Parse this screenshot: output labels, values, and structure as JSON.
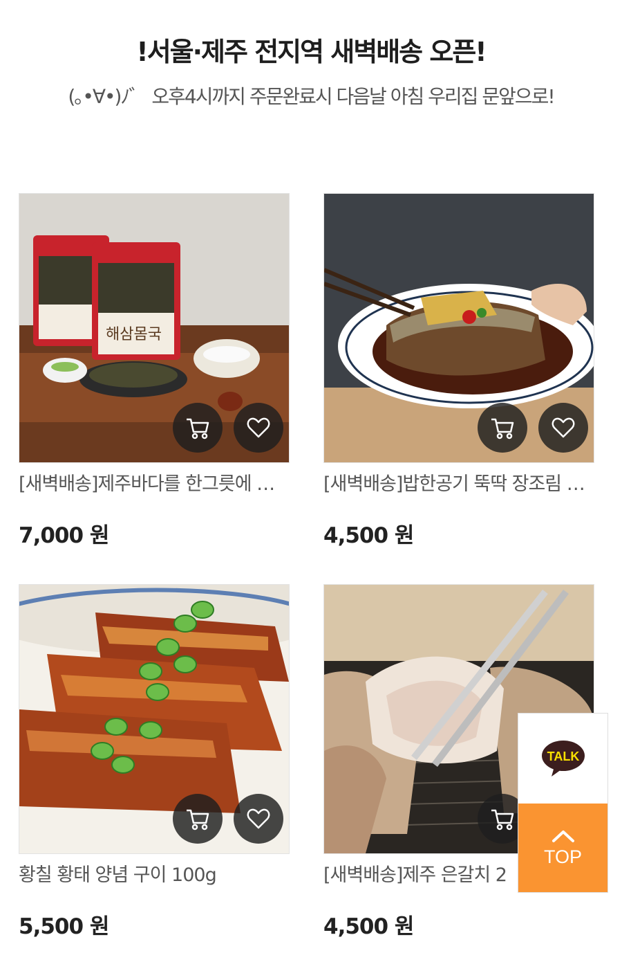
{
  "banner": {
    "title": "!서울·제주 전지역 새벽배송 오픈!",
    "subtitle": "(｡•∀•)ﾉ゛ 오후4시까지 주문완료시 다음날 아침 우리집 문앞으로!"
  },
  "products": [
    {
      "name": "[새벽배송]제주바다를 한그릇에 담은 해삼몸국",
      "price": "7,000 원"
    },
    {
      "name": "[새벽배송]밥한공기 뚝딱 장조림 고등어",
      "price": "4,500 원"
    },
    {
      "name": "황칠 황태 양념 구이 100g",
      "price": "5,500 원"
    },
    {
      "name": "[새벽배송]제주 은갈치 2",
      "price": "4,500 원"
    }
  ],
  "floating": {
    "talk_label": "TALK",
    "top_label": "TOP"
  },
  "colors": {
    "accent": "#fa9431",
    "kakao": "#3c1e1e"
  }
}
